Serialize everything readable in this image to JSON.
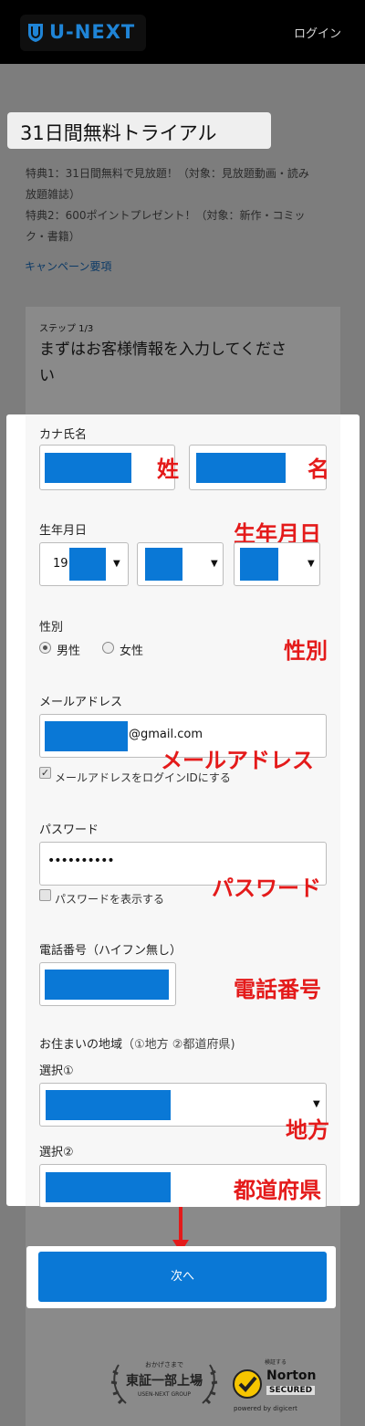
{
  "header": {
    "logo_text": "U-NEXT",
    "login": "ログイン"
  },
  "title": "31日間無料トライアル",
  "benefits": {
    "line1": "特典1：31日間無料で見放題！（対象：見放題動画・読み",
    "line2": "放題雑誌）",
    "line3": "特典2：600ポイントプレゼント！（対象：新作・コミッ",
    "line4": "ク・書籍）"
  },
  "campaign_link": "キャンペーン要項",
  "step": {
    "label": "ステップ 1/3",
    "title_line1": "まずはお客様情報を入力してくださ",
    "title_line2": "い"
  },
  "form": {
    "kana_label": "カナ氏名",
    "birth_label": "生年月日",
    "birth_year_prefix": "19",
    "gender_label": "性別",
    "gender_male": "男性",
    "gender_female": "女性",
    "email_label": "メールアドレス",
    "email_suffix": "@gmail.com",
    "email_as_id": "メールアドレスをログインIDにする",
    "password_label": "パスワード",
    "password_value": "••••••••••",
    "show_password": "パスワードを表示する",
    "phone_label": "電話番号（ハイフン無し）",
    "address_label": "お住まいの地域",
    "address_hint": "（①地方 ②都道府県)",
    "select1_label": "選択①",
    "select2_label": "選択②"
  },
  "annotations": {
    "sei": "姓",
    "mei": "名",
    "birthday": "生年月日",
    "gender": "性別",
    "email": "メールアドレス",
    "password": "パスワード",
    "phone": "電話番号",
    "region": "地方",
    "prefecture": "都道府県"
  },
  "next_button": "次へ",
  "footer": {
    "badge1_top": "おかげさまで",
    "badge1_main": "東証一部上場",
    "badge1_bottom": "USEN-NEXT GROUP",
    "badge2_top": "検証する",
    "badge2_brand": "Norton",
    "badge2_secured": "SECURED",
    "badge2_powered": "powered by digicert"
  },
  "colors": {
    "accent": "#0a78d6",
    "annotation": "#e41a1a",
    "overlay": "#7d7d7d"
  }
}
